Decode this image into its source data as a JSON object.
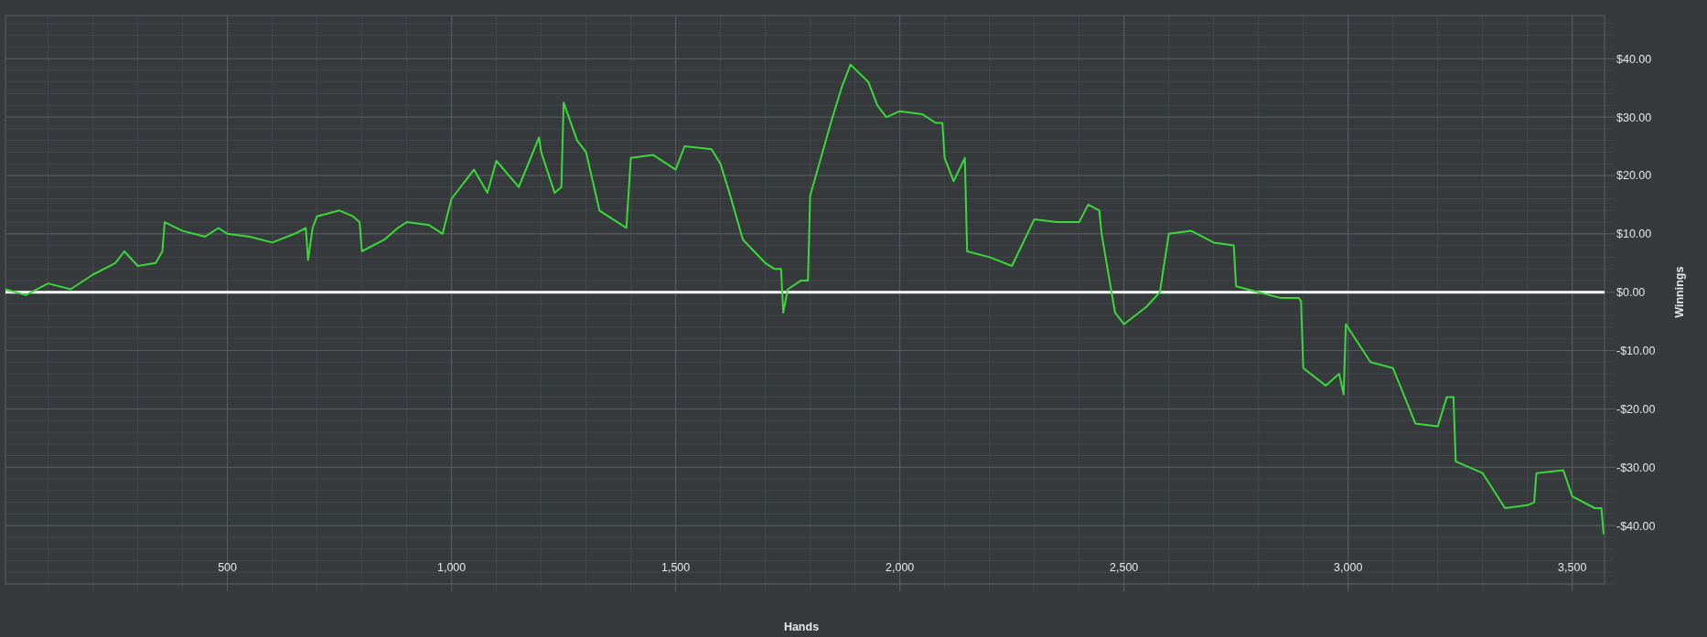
{
  "chart": {
    "chart_data": {
      "type": "line",
      "xlabel": "Hands",
      "ylabel": "Winnings",
      "x": [
        5,
        50,
        100,
        150,
        200,
        250,
        270,
        300,
        340,
        355,
        360,
        400,
        450,
        480,
        500,
        550,
        600,
        650,
        675,
        680,
        690,
        700,
        750,
        780,
        795,
        800,
        850,
        880,
        900,
        950,
        980,
        1000,
        1050,
        1080,
        1100,
        1150,
        1195,
        1200,
        1230,
        1245,
        1250,
        1280,
        1300,
        1330,
        1370,
        1390,
        1400,
        1450,
        1500,
        1520,
        1580,
        1600,
        1620,
        1650,
        1700,
        1720,
        1735,
        1740,
        1750,
        1780,
        1795,
        1800,
        1850,
        1870,
        1890,
        1930,
        1950,
        1970,
        2000,
        2050,
        2080,
        2095,
        2100,
        2120,
        2145,
        2150,
        2200,
        2250,
        2300,
        2350,
        2400,
        2420,
        2445,
        2450,
        2480,
        2500,
        2550,
        2580,
        2600,
        2650,
        2700,
        2745,
        2750,
        2800,
        2850,
        2890,
        2895,
        2900,
        2950,
        2980,
        2990,
        2995,
        3050,
        3100,
        3150,
        3200,
        3220,
        3235,
        3240,
        3300,
        3350,
        3400,
        3415,
        3420,
        3480,
        3500,
        3550,
        3565,
        3570
      ],
      "series": [
        {
          "color": "#3ad83a",
          "values": [
            0.5,
            -0.5,
            1.5,
            0.5,
            3,
            5,
            7,
            4.5,
            5,
            7,
            12,
            10.5,
            9.5,
            11,
            10,
            9.5,
            8.5,
            10,
            11,
            5.5,
            11,
            13,
            14,
            13,
            12,
            7,
            9,
            11,
            12,
            11.5,
            10,
            16,
            21,
            17,
            22.5,
            18,
            26.5,
            24,
            17,
            18,
            32.5,
            26,
            24,
            14,
            12,
            11,
            23,
            23.5,
            21,
            25,
            24.5,
            22,
            17,
            9,
            5,
            4,
            4,
            -3.5,
            0.5,
            2,
            2,
            16.5,
            30,
            35,
            39,
            36,
            32,
            30,
            31,
            30.5,
            29,
            29,
            23,
            19,
            23,
            7,
            6,
            4.5,
            12.5,
            12,
            12,
            15,
            14,
            10,
            -3.5,
            -5.5,
            -2.5,
            0,
            10,
            10.5,
            8.5,
            8,
            1,
            0,
            -1,
            -1,
            -1.5,
            -13,
            -16,
            -14,
            -17.5,
            -5.5,
            -12,
            -13,
            -22.5,
            -23,
            -18,
            -18,
            -29,
            -31,
            -37,
            -36.5,
            -36,
            -31,
            -30.5,
            -35,
            -37,
            -37,
            -41.5
          ]
        }
      ],
      "xlim": [
        5,
        3572
      ],
      "ylim": [
        -50,
        47.4
      ],
      "xticks": [
        {
          "value": 500,
          "label": "500"
        },
        {
          "value": 1000,
          "label": "1,000"
        },
        {
          "value": 1500,
          "label": "1,500"
        },
        {
          "value": 2000,
          "label": "2,000"
        },
        {
          "value": 2500,
          "label": "2,500"
        },
        {
          "value": 3000,
          "label": "3,000"
        },
        {
          "value": 3500,
          "label": "3,500"
        }
      ],
      "yticks": [
        {
          "value": 40,
          "label": "$40.00"
        },
        {
          "value": 30,
          "label": "$30.00"
        },
        {
          "value": 20,
          "label": "$20.00"
        },
        {
          "value": 10,
          "label": "$10.00"
        },
        {
          "value": 0,
          "label": "$0.00"
        },
        {
          "value": -10,
          "label": "-$10.00"
        },
        {
          "value": -20,
          "label": "-$20.00"
        },
        {
          "value": -30,
          "label": "-$30.00"
        },
        {
          "value": -40,
          "label": "-$40.00"
        }
      ],
      "grid": true,
      "ref_lines": [
        {
          "axis": "y",
          "value": 0
        }
      ]
    }
  }
}
